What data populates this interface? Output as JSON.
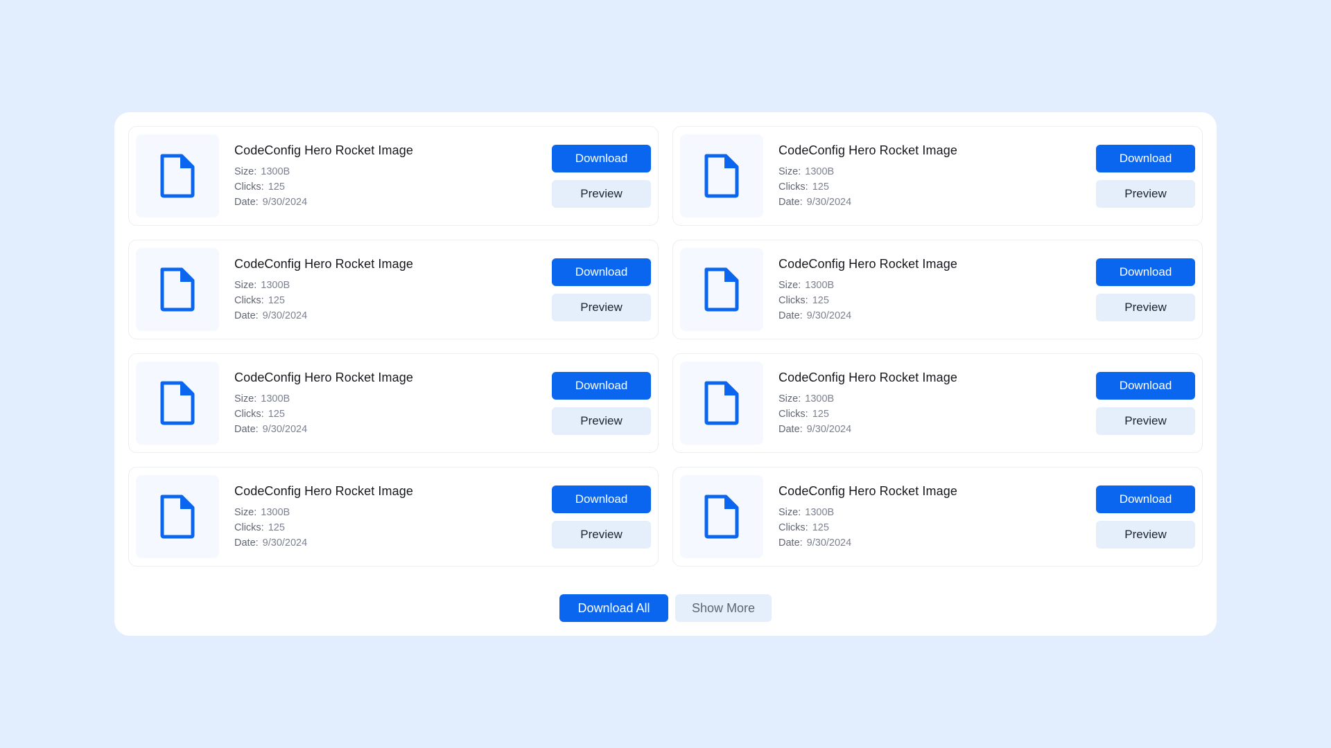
{
  "colors": {
    "background": "#e2eefd",
    "accent": "#0a66ee",
    "secondary_button": "#e5eefb",
    "icon": "#0a66ee"
  },
  "files": [
    {
      "title": "CodeConfig Hero Rocket Image",
      "size_label": "Size:",
      "size": "1300B",
      "clicks_label": "Clicks:",
      "clicks": "125",
      "date_label": "Date:",
      "date": "9/30/2024",
      "download_label": "Download",
      "preview_label": "Preview",
      "icon": "file-icon"
    },
    {
      "title": "CodeConfig Hero Rocket Image",
      "size_label": "Size:",
      "size": "1300B",
      "clicks_label": "Clicks:",
      "clicks": "125",
      "date_label": "Date:",
      "date": "9/30/2024",
      "download_label": "Download",
      "preview_label": "Preview",
      "icon": "file-icon"
    },
    {
      "title": "CodeConfig Hero Rocket Image",
      "size_label": "Size:",
      "size": "1300B",
      "clicks_label": "Clicks:",
      "clicks": "125",
      "date_label": "Date:",
      "date": "9/30/2024",
      "download_label": "Download",
      "preview_label": "Preview",
      "icon": "file-icon"
    },
    {
      "title": "CodeConfig Hero Rocket Image",
      "size_label": "Size:",
      "size": "1300B",
      "clicks_label": "Clicks:",
      "clicks": "125",
      "date_label": "Date:",
      "date": "9/30/2024",
      "download_label": "Download",
      "preview_label": "Preview",
      "icon": "file-icon"
    },
    {
      "title": "CodeConfig Hero Rocket Image",
      "size_label": "Size:",
      "size": "1300B",
      "clicks_label": "Clicks:",
      "clicks": "125",
      "date_label": "Date:",
      "date": "9/30/2024",
      "download_label": "Download",
      "preview_label": "Preview",
      "icon": "file-icon"
    },
    {
      "title": "CodeConfig Hero Rocket Image",
      "size_label": "Size:",
      "size": "1300B",
      "clicks_label": "Clicks:",
      "clicks": "125",
      "date_label": "Date:",
      "date": "9/30/2024",
      "download_label": "Download",
      "preview_label": "Preview",
      "icon": "file-icon"
    },
    {
      "title": "CodeConfig Hero Rocket Image",
      "size_label": "Size:",
      "size": "1300B",
      "clicks_label": "Clicks:",
      "clicks": "125",
      "date_label": "Date:",
      "date": "9/30/2024",
      "download_label": "Download",
      "preview_label": "Preview",
      "icon": "file-icon"
    },
    {
      "title": "CodeConfig Hero Rocket Image",
      "size_label": "Size:",
      "size": "1300B",
      "clicks_label": "Clicks:",
      "clicks": "125",
      "date_label": "Date:",
      "date": "9/30/2024",
      "download_label": "Download",
      "preview_label": "Preview",
      "icon": "file-icon"
    }
  ],
  "footer": {
    "download_all_label": "Download All",
    "show_more_label": "Show More"
  }
}
